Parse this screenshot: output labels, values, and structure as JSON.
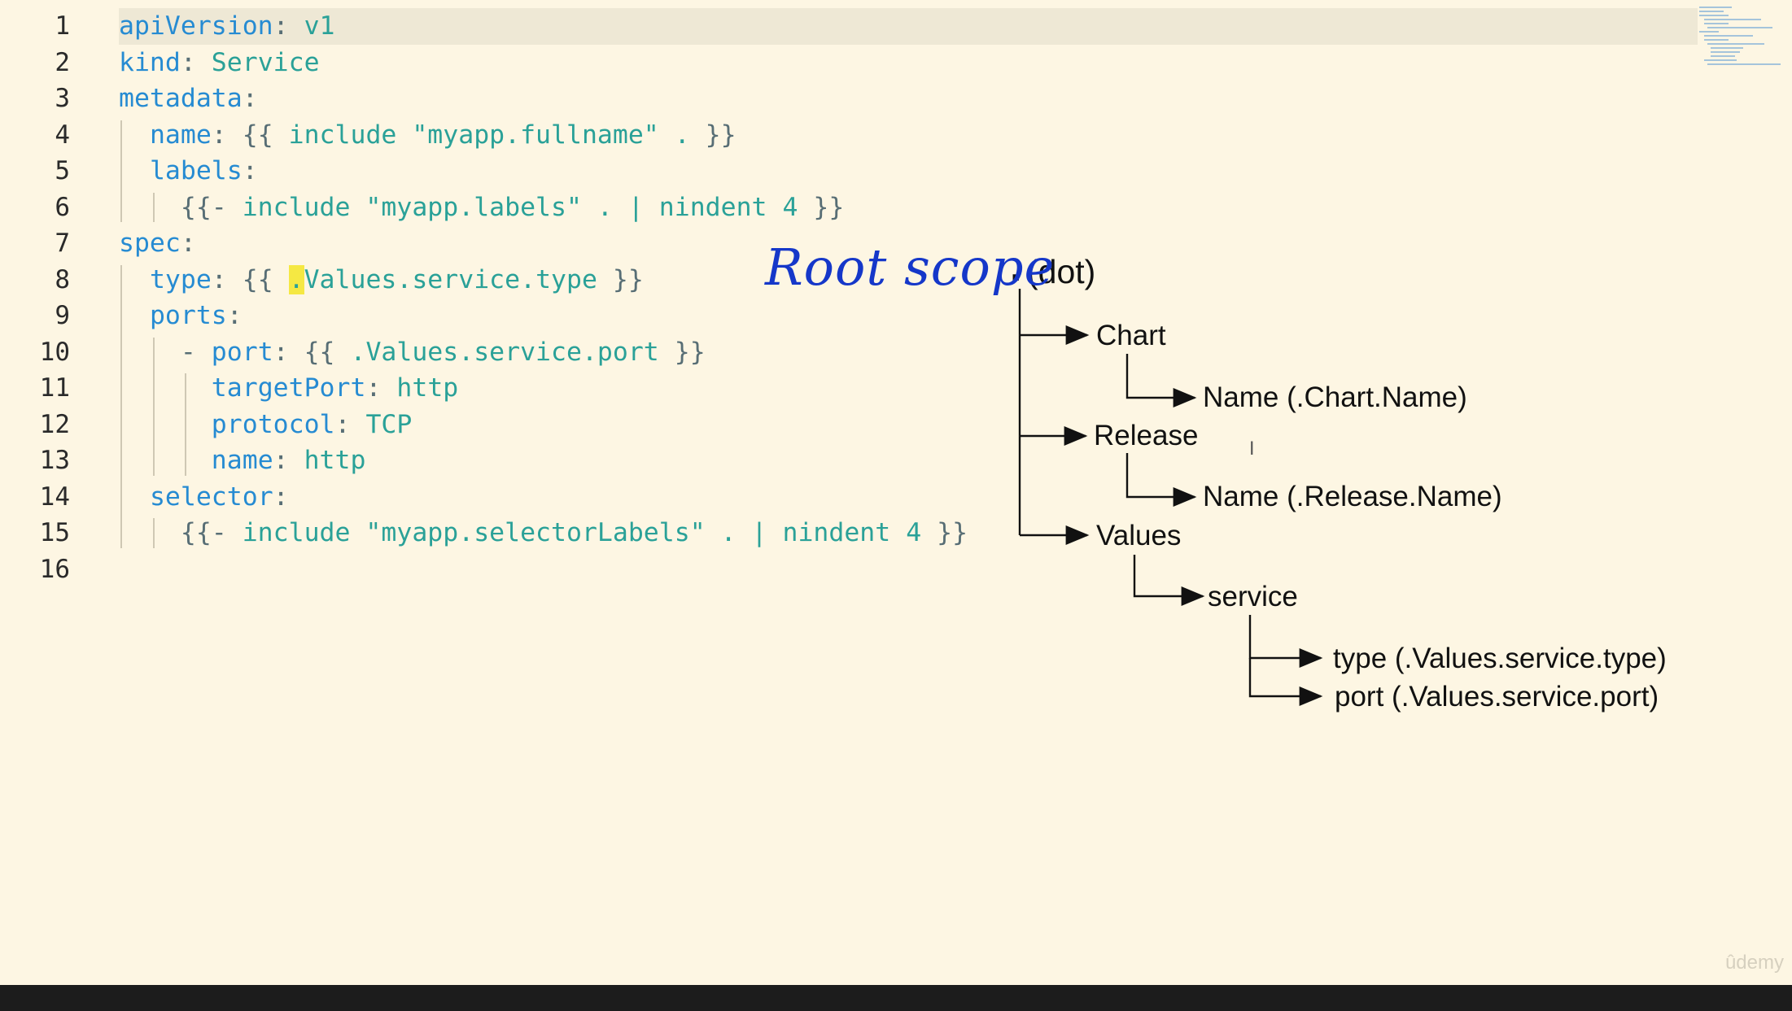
{
  "editor": {
    "lines": [
      {
        "num": "1",
        "segments": [
          {
            "t": "apiVersion",
            "c": "k"
          },
          {
            "t": ": ",
            "c": "p"
          },
          {
            "t": "v1",
            "c": "s"
          }
        ]
      },
      {
        "num": "2",
        "segments": [
          {
            "t": "kind",
            "c": "k"
          },
          {
            "t": ": ",
            "c": "p"
          },
          {
            "t": "Service",
            "c": "s"
          }
        ]
      },
      {
        "num": "3",
        "segments": [
          {
            "t": "metadata",
            "c": "k"
          },
          {
            "t": ":",
            "c": "p"
          }
        ]
      },
      {
        "num": "4",
        "segments": [
          {
            "t": "  ",
            "c": "p"
          },
          {
            "t": "name",
            "c": "k"
          },
          {
            "t": ": {{ ",
            "c": "p"
          },
          {
            "t": "include \"myapp.fullname\" .",
            "c": "s"
          },
          {
            "t": " }}",
            "c": "p"
          }
        ]
      },
      {
        "num": "5",
        "segments": [
          {
            "t": "  ",
            "c": "p"
          },
          {
            "t": "labels",
            "c": "k"
          },
          {
            "t": ":",
            "c": "p"
          }
        ]
      },
      {
        "num": "6",
        "segments": [
          {
            "t": "    {{- ",
            "c": "p"
          },
          {
            "t": "include \"myapp.labels\" . | nindent 4",
            "c": "s"
          },
          {
            "t": " }}",
            "c": "p"
          }
        ]
      },
      {
        "num": "7",
        "segments": [
          {
            "t": "spec",
            "c": "k"
          },
          {
            "t": ":",
            "c": "p"
          }
        ]
      },
      {
        "num": "8",
        "segments": [
          {
            "t": "  ",
            "c": "p"
          },
          {
            "t": "type",
            "c": "k"
          },
          {
            "t": ": {{ ",
            "c": "p"
          },
          {
            "t": ".",
            "c": "s",
            "hl": true
          },
          {
            "t": "Values.service.type",
            "c": "s"
          },
          {
            "t": " }}",
            "c": "p"
          }
        ]
      },
      {
        "num": "9",
        "segments": [
          {
            "t": "  ",
            "c": "p"
          },
          {
            "t": "ports",
            "c": "k"
          },
          {
            "t": ":",
            "c": "p"
          }
        ]
      },
      {
        "num": "10",
        "segments": [
          {
            "t": "    - ",
            "c": "p"
          },
          {
            "t": "port",
            "c": "k"
          },
          {
            "t": ": {{ ",
            "c": "p"
          },
          {
            "t": ".Values.service.port",
            "c": "s"
          },
          {
            "t": " }}",
            "c": "p"
          }
        ]
      },
      {
        "num": "11",
        "segments": [
          {
            "t": "      ",
            "c": "p"
          },
          {
            "t": "targetPort",
            "c": "k"
          },
          {
            "t": ": ",
            "c": "p"
          },
          {
            "t": "http",
            "c": "s"
          }
        ]
      },
      {
        "num": "12",
        "segments": [
          {
            "t": "      ",
            "c": "p"
          },
          {
            "t": "protocol",
            "c": "k"
          },
          {
            "t": ": ",
            "c": "p"
          },
          {
            "t": "TCP",
            "c": "s"
          }
        ]
      },
      {
        "num": "13",
        "segments": [
          {
            "t": "      ",
            "c": "p"
          },
          {
            "t": "name",
            "c": "k"
          },
          {
            "t": ": ",
            "c": "p"
          },
          {
            "t": "http",
            "c": "s"
          }
        ]
      },
      {
        "num": "14",
        "segments": [
          {
            "t": "  ",
            "c": "p"
          },
          {
            "t": "selector",
            "c": "k"
          },
          {
            "t": ":",
            "c": "p"
          }
        ]
      },
      {
        "num": "15",
        "segments": [
          {
            "t": "    {{- ",
            "c": "p"
          },
          {
            "t": "include \"myapp.selectorLabels\" . | nindent 4",
            "c": "s"
          },
          {
            "t": " }}",
            "c": "p"
          }
        ]
      },
      {
        "num": "16",
        "segments": []
      }
    ],
    "current_line": "1"
  },
  "diagram": {
    "annotation": "Root scope",
    "root_dot": ".",
    "root_label": "(dot)",
    "nodes": {
      "chart": "Chart",
      "chart_name": "Name (.Chart.Name)",
      "release": "Release",
      "release_name": "Name (.Release.Name)",
      "values": "Values",
      "service": "service",
      "service_type": "type (.Values.service.type)",
      "service_port": "port (.Values.service.port)"
    }
  },
  "watermark": "ûdemy",
  "cursor_glyph": "I",
  "colors": {
    "background": "#fdf6e3",
    "key": "#268bd2",
    "string": "#2aa198",
    "punct": "#586e75",
    "highlight": "#f5e843",
    "annotation": "#1537c9"
  }
}
